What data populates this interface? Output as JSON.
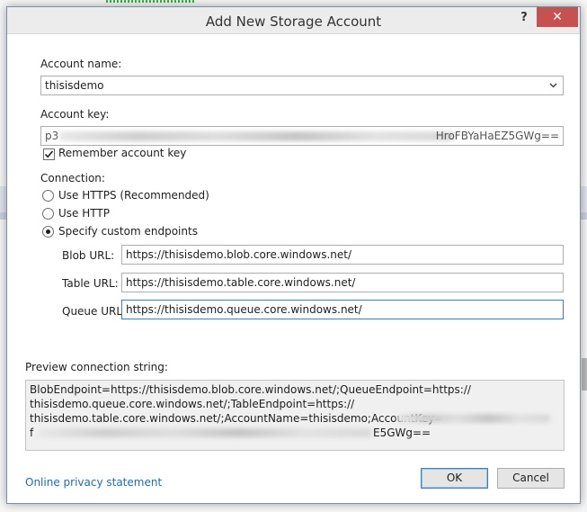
{
  "dialog": {
    "title": "Add New Storage Account",
    "help_label": "?",
    "close_label": "✕"
  },
  "account_name": {
    "label": "Account name:",
    "value": "thisisdemo"
  },
  "account_key": {
    "label": "Account key:",
    "visible_start": "p3",
    "visible_end": "HroFBYaHaEZ5GWg==",
    "remember_label": "Remember account key",
    "remember_checked": true
  },
  "connection": {
    "label": "Connection:",
    "options": [
      {
        "label": "Use HTTPS (Recommended)",
        "selected": false
      },
      {
        "label": "Use HTTP",
        "selected": false
      },
      {
        "label": "Specify custom endpoints",
        "selected": true
      }
    ]
  },
  "endpoints": {
    "blob_label": "Blob URL:",
    "blob_value": "https://thisisdemo.blob.core.windows.net/",
    "table_label": "Table URL:",
    "table_value": "https://thisisdemo.table.core.windows.net/",
    "queue_label": "Queue URL:",
    "queue_value": "https://thisisdemo.queue.core.windows.net/"
  },
  "preview": {
    "label": "Preview connection string:",
    "line1": "BlobEndpoint=https://thisisdemo.blob.core.windows.net/;QueueEndpoint=https://",
    "line2": "thisisdemo.queue.core.windows.net/;TableEndpoint=https://",
    "line3": "thisisdemo.table.core.windows.net/;AccountName=thisisdemo;AccountKey=",
    "line4_start": "f",
    "line4_end": "E5GWg=="
  },
  "footer": {
    "privacy_link": "Online privacy statement",
    "ok_label": "OK",
    "cancel_label": "Cancel"
  },
  "colors": {
    "close_button": "#c75050",
    "link": "#1e6bb8",
    "focus_border": "#3c7fb1"
  }
}
